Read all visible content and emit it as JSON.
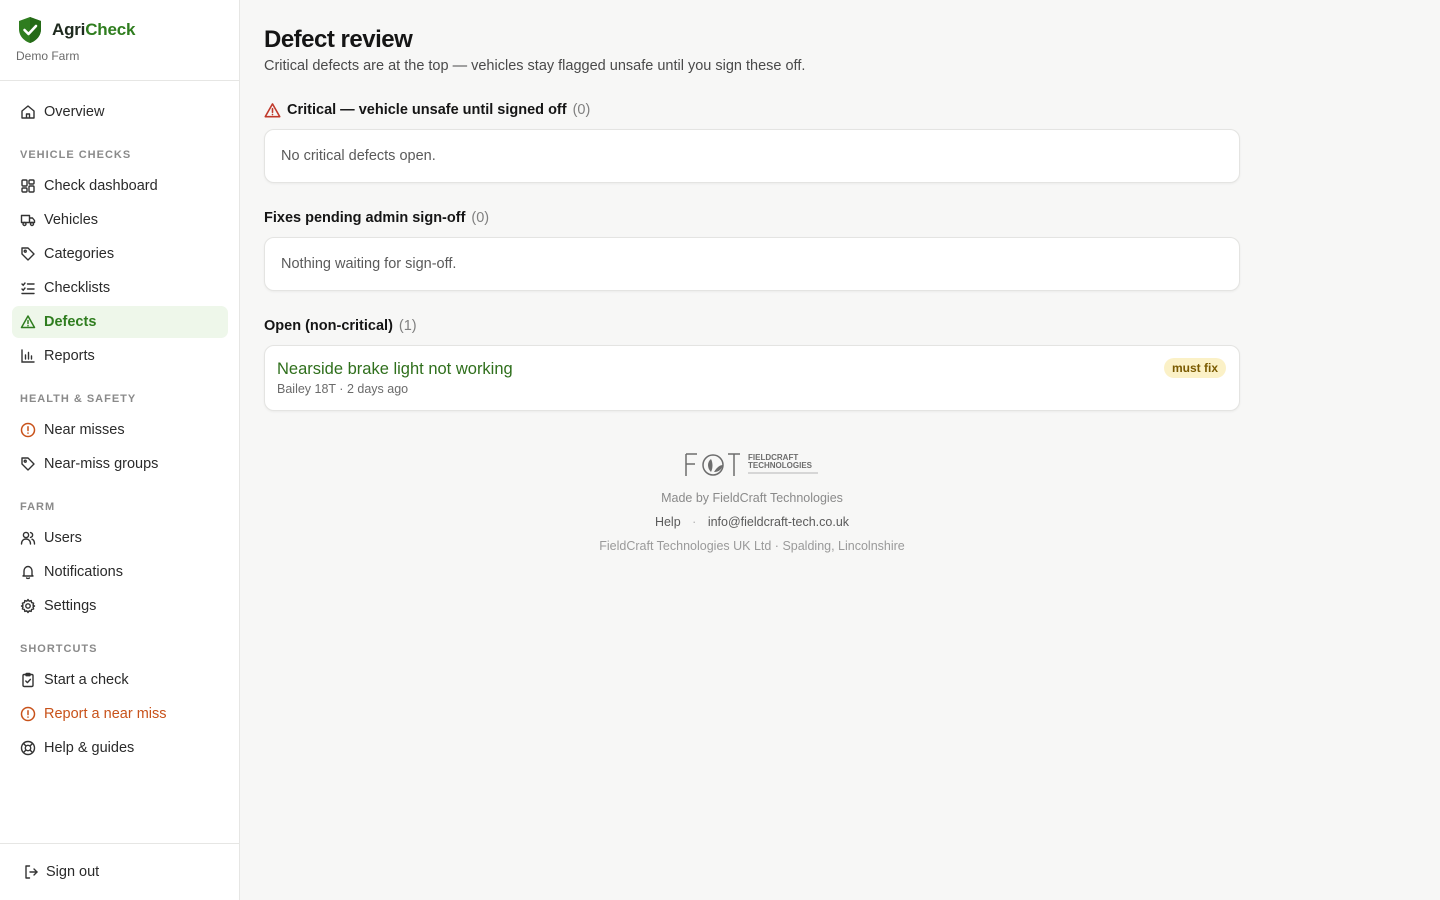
{
  "brand": {
    "name_part1": "Agri",
    "name_part2": "Check",
    "farm": "Demo Farm"
  },
  "nav": {
    "overview": "Overview",
    "vehicle_checks_label": "VEHICLE CHECKS",
    "check_dashboard": "Check dashboard",
    "vehicles": "Vehicles",
    "categories": "Categories",
    "checklists": "Checklists",
    "defects": "Defects",
    "reports": "Reports",
    "health_safety_label": "HEALTH & SAFETY",
    "near_misses": "Near misses",
    "near_miss_groups": "Near-miss groups",
    "farm_label": "FARM",
    "users": "Users",
    "notifications": "Notifications",
    "settings": "Settings",
    "shortcuts_label": "SHORTCUTS",
    "start_check": "Start a check",
    "report_near_miss": "Report a near miss",
    "help_guides": "Help & guides",
    "sign_out": "Sign out"
  },
  "page": {
    "title": "Defect review",
    "subtitle": "Critical defects are at the top — vehicles stay flagged unsafe until you sign these off."
  },
  "sections": {
    "critical": {
      "title": "Critical — vehicle unsafe until signed off",
      "count": "(0)",
      "empty": "No critical defects open."
    },
    "pending": {
      "title": "Fixes pending admin sign-off",
      "count": "(0)",
      "empty": "Nothing waiting for sign-off."
    },
    "open": {
      "title": "Open (non-critical)",
      "count": "(1)",
      "items": [
        {
          "title": "Nearside brake light not working",
          "meta": "Bailey 18T · 2 days ago",
          "badge": "must fix"
        }
      ]
    }
  },
  "footer": {
    "logo_text": "FCT FIELDCRAFT TECHNOLOGIES",
    "made_by": "Made by FieldCraft Technologies",
    "help": "Help",
    "separator": "·",
    "email": "info@fieldcraft-tech.co.uk",
    "address": "FieldCraft Technologies UK Ltd · Spalding, Lincolnshire"
  },
  "colors": {
    "brand_green": "#2f7d1f",
    "warning_orange": "#c8521a",
    "critical_red": "#c0392b",
    "badge_bg": "#fbf1c7"
  }
}
